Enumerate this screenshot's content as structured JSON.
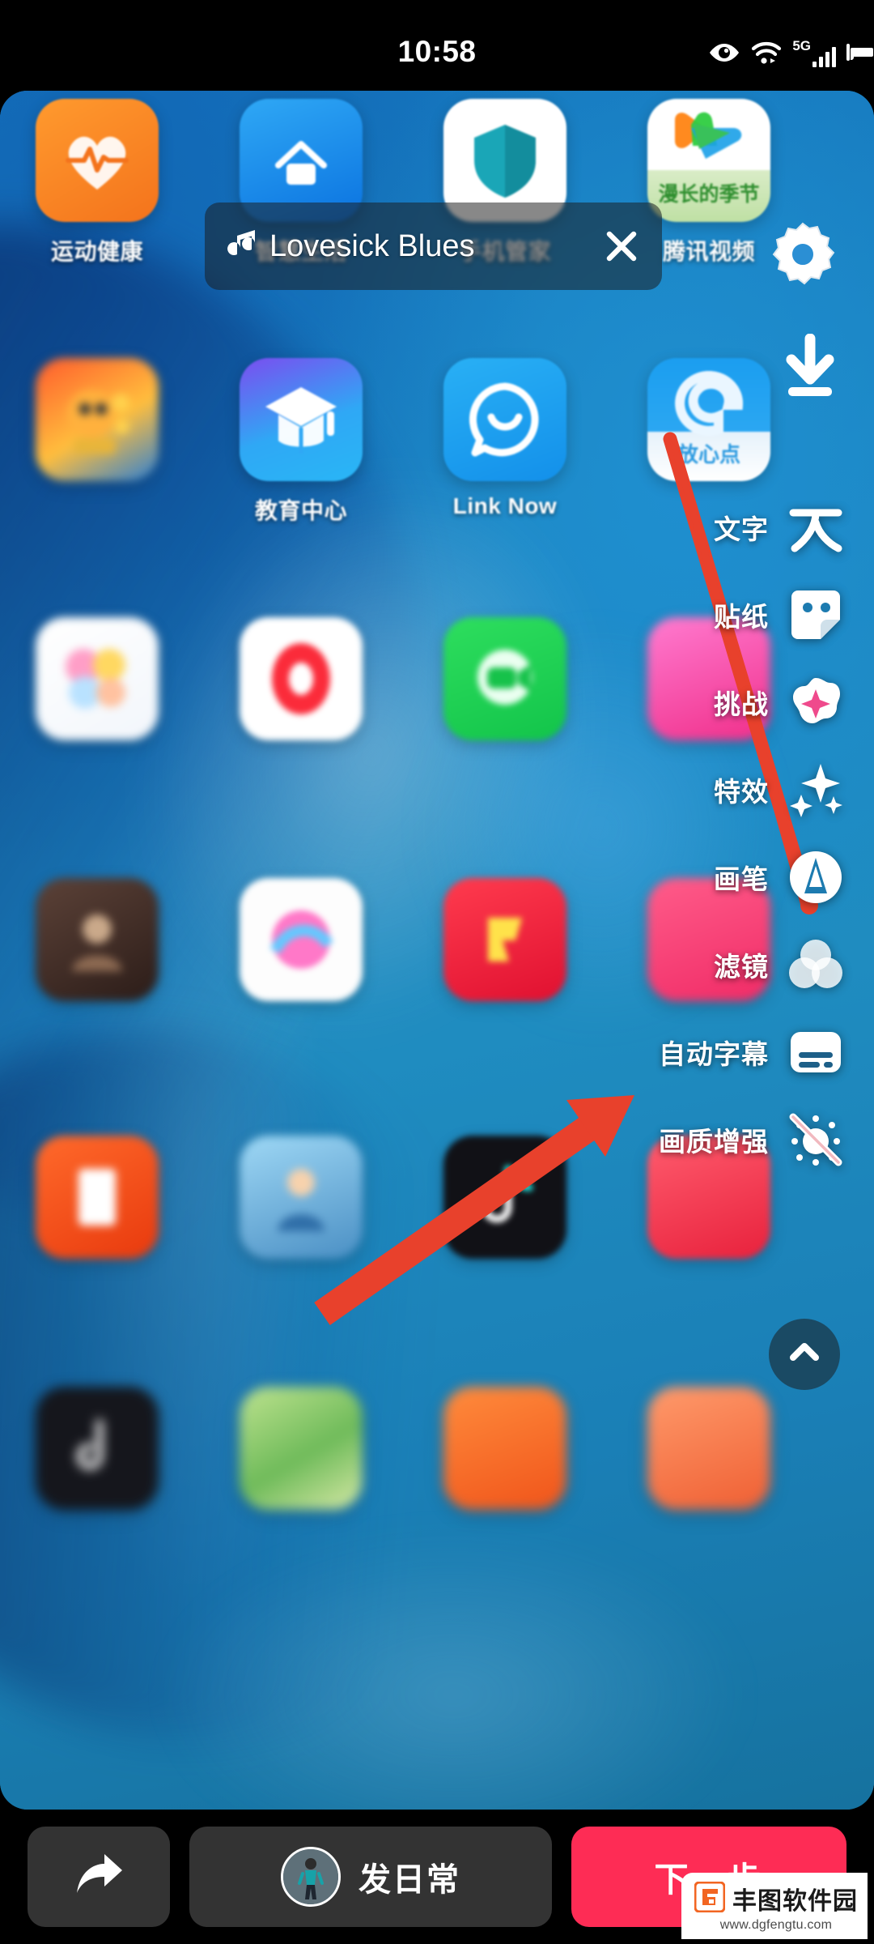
{
  "status_bar": {
    "time": "10:58",
    "icons": [
      "eye-comfort-icon",
      "wifi-icon",
      "5g-signal-icon",
      "battery-icon"
    ],
    "network_label": "5G"
  },
  "music_pill": {
    "icon": "music-note-icon",
    "title": "Lovesick Blues",
    "close_icon": "close-icon"
  },
  "top_right": {
    "settings_icon": "gear-icon",
    "download_icon": "download-icon"
  },
  "toolbar": {
    "items": [
      {
        "label": "文字",
        "icon": "text-icon"
      },
      {
        "label": "贴纸",
        "icon": "sticker-icon"
      },
      {
        "label": "挑战",
        "icon": "challenge-star-icon"
      },
      {
        "label": "特效",
        "icon": "sparkles-icon"
      },
      {
        "label": "画笔",
        "icon": "brush-icon"
      },
      {
        "label": "滤镜",
        "icon": "filter-circles-icon"
      },
      {
        "label": "自动字幕",
        "icon": "subtitle-icon"
      },
      {
        "label": "画质增强",
        "icon": "enhance-off-icon"
      }
    ],
    "collapse_icon": "chevron-up-icon"
  },
  "bottom_bar": {
    "share_icon": "share-arrow-icon",
    "daily_label": "发日常",
    "daily_avatar": "avatar",
    "next_label": "下一步",
    "next_color": "#fe2c55"
  },
  "watermark": {
    "name": "丰图软件园",
    "url": "www.dgfengtu.com",
    "logo_color": "#f26522"
  },
  "home_screen": {
    "apps": [
      {
        "label": "运动健康",
        "row": 1,
        "col": 1
      },
      {
        "label": "智慧生活",
        "row": 1,
        "col": 2
      },
      {
        "label": "手机管家",
        "row": 1,
        "col": 3
      },
      {
        "label": "腾讯视频",
        "row": 1,
        "col": 4
      },
      {
        "label": "",
        "row": 2,
        "col": 1
      },
      {
        "label": "教育中心",
        "row": 2,
        "col": 2
      },
      {
        "label": "Link Now",
        "row": 2,
        "col": 3
      },
      {
        "label": "",
        "row": 2,
        "col": 4
      }
    ]
  },
  "annotations": {
    "arrow_1_target": "特效",
    "arrow_2_target": "自动字幕",
    "color": "#e8412c"
  }
}
